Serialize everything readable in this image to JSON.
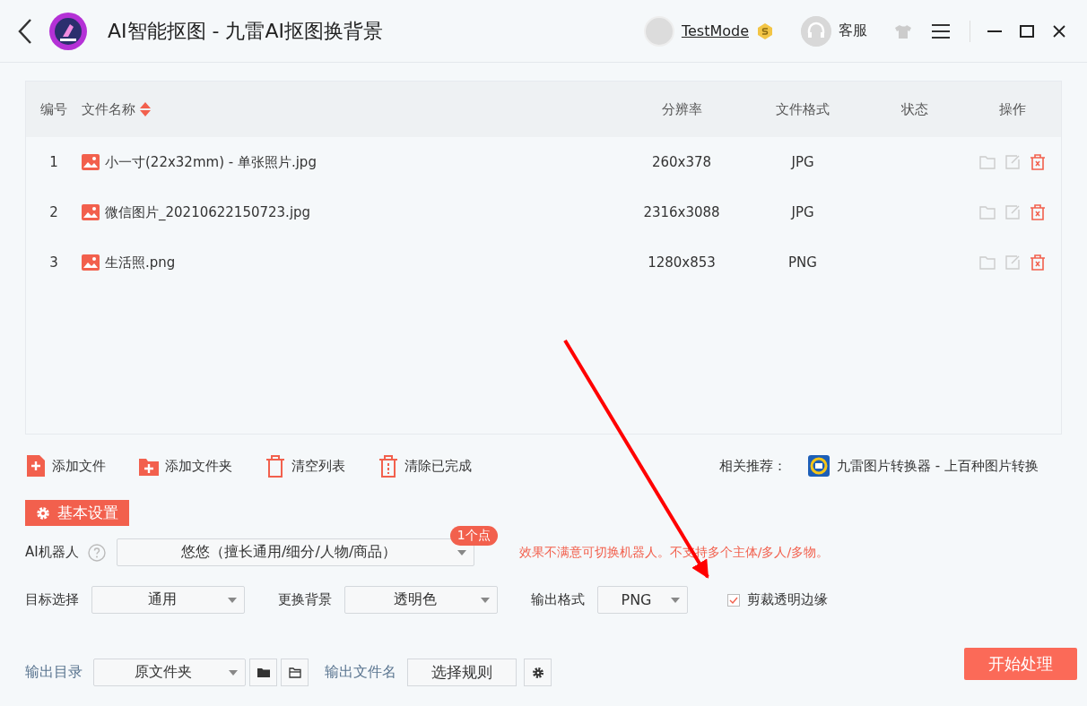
{
  "window": {
    "title": "AI智能抠图 - 九雷AI抠图换背景",
    "user": "TestMode",
    "service": "客服"
  },
  "table": {
    "columns": [
      "编号",
      "文件名称",
      "分辨率",
      "文件格式",
      "状态",
      "操作"
    ],
    "rows": [
      {
        "index": "1",
        "name": "小一寸(22x32mm) - 单张照片.jpg",
        "resolution": "260x378",
        "format": "JPG"
      },
      {
        "index": "2",
        "name": "微信图片_20210622150723.jpg",
        "resolution": "2316x3088",
        "format": "JPG"
      },
      {
        "index": "3",
        "name": "生活照.png",
        "resolution": "1280x853",
        "format": "PNG"
      }
    ]
  },
  "toolbar": [
    {
      "kind": "add-file",
      "label": "添加文件"
    },
    {
      "kind": "add-folder",
      "label": "添加文件夹"
    },
    {
      "kind": "clear",
      "label": "清空列表"
    },
    {
      "kind": "clear-done",
      "label": "清除已完成"
    }
  ],
  "recommend": {
    "label": "相关推荐：",
    "app": "九雷图片转换器 - 上百种图片转换"
  },
  "settings": {
    "tab": "基本设置",
    "robot": {
      "label": "AI机器人",
      "value": "悠悠（擅长通用/细分/人物/商品）",
      "badge": "1个点",
      "hint": "效果不满意可切换机器人。不支持多个主体/多人/多物。"
    },
    "options": [
      {
        "label": "目标选择",
        "value": "通用"
      },
      {
        "label": "更换背景",
        "value": "透明色"
      },
      {
        "label": "输出格式",
        "value": "PNG"
      }
    ],
    "crop": {
      "label": "剪裁透明边缘",
      "checked": true
    }
  },
  "output": {
    "dir_label": "输出目录",
    "dir_value": "原文件夹",
    "name_label": "输出文件名",
    "rule": "选择规则",
    "start": "开始处理"
  }
}
